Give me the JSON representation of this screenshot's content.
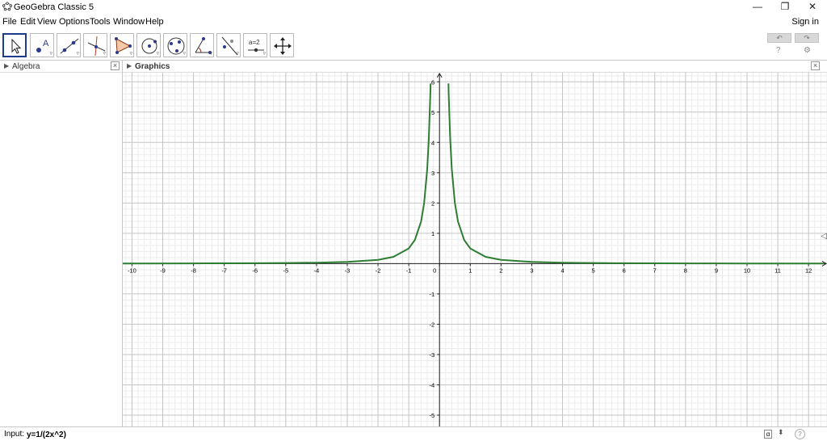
{
  "window": {
    "title": "GeoGebra Classic 5",
    "minimize": "—",
    "restore": "❐",
    "close": "✕"
  },
  "menu": {
    "items": [
      "File",
      "Edit",
      "View",
      "Options",
      "Tools",
      "Window",
      "Help"
    ],
    "sign_in": "Sign in"
  },
  "toolbar": {
    "tools": [
      {
        "name": "move-tool",
        "icon": "arrow-pointer-icon",
        "selected": true
      },
      {
        "name": "point-tool",
        "icon": "point-icon",
        "label": "A"
      },
      {
        "name": "line-tool",
        "icon": "line-icon"
      },
      {
        "name": "perpendicular-line-tool",
        "icon": "perpendicular-icon"
      },
      {
        "name": "polygon-tool",
        "icon": "polygon-icon"
      },
      {
        "name": "circle-tool",
        "icon": "circle-icon"
      },
      {
        "name": "ellipse-tool",
        "icon": "ellipse-icon"
      },
      {
        "name": "angle-tool",
        "icon": "angle-icon"
      },
      {
        "name": "reflect-tool",
        "icon": "reflect-icon"
      },
      {
        "name": "slider-tool",
        "icon": "slider-icon",
        "label": "a=2"
      },
      {
        "name": "move-graphics-view-tool",
        "icon": "move-view-icon"
      }
    ],
    "undo": "↶",
    "redo": "↷",
    "help_icon": "?",
    "settings_icon": "⚙"
  },
  "algebra": {
    "title": "Algebra",
    "close": "×"
  },
  "graphics": {
    "title": "Graphics",
    "close": "×",
    "collapse_arrow": "◁"
  },
  "chart_data": {
    "type": "line",
    "function": "y=1/(2x^2)",
    "series": [
      {
        "color": "#2e7d32",
        "x": [
          -10.3,
          -8,
          -6,
          -5,
          -4,
          -3,
          -2,
          -1.5,
          -1,
          -0.8,
          -0.6,
          -0.5,
          -0.4,
          -0.35,
          -0.3,
          -0.29,
          0.29,
          0.3,
          0.35,
          0.4,
          0.5,
          0.6,
          0.8,
          1,
          1.5,
          2,
          3,
          4,
          5,
          6,
          8,
          10,
          12.5
        ],
        "y": [
          0.0047,
          0.0078,
          0.0139,
          0.02,
          0.0313,
          0.0556,
          0.125,
          0.2222,
          0.5,
          0.7813,
          1.3889,
          2,
          3.125,
          4.0816,
          5.5556,
          5.9453,
          5.9453,
          5.5556,
          4.0816,
          3.125,
          2,
          1.3889,
          0.7813,
          0.5,
          0.2222,
          0.125,
          0.0556,
          0.0313,
          0.02,
          0.0139,
          0.0078,
          0.005,
          0.0032
        ]
      }
    ],
    "xlim": [
      -10.3,
      12.6
    ],
    "ylim": [
      -5.4,
      6.3
    ],
    "x_ticks": [
      "-10",
      "-9",
      "-8",
      "-7",
      "-6",
      "-5",
      "-4",
      "-3",
      "-2",
      "-1",
      "0",
      "1",
      "2",
      "3",
      "4",
      "5",
      "6",
      "7",
      "8",
      "9",
      "10",
      "11",
      "12"
    ],
    "y_ticks": [
      "-5",
      "-4",
      "-3",
      "-2",
      "-1",
      "1",
      "2",
      "3",
      "4",
      "5",
      "6"
    ],
    "grid": true
  },
  "inputbar": {
    "label": "Input:",
    "value": "y=1/(2x^2)",
    "alpha_button": "α",
    "spinner": "⬍",
    "help": "?"
  }
}
